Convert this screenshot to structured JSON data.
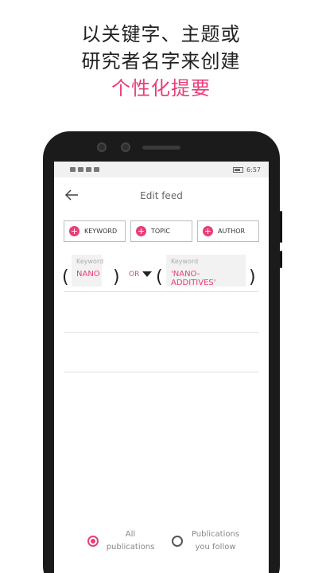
{
  "headline": {
    "line1": "以关键字、主题或",
    "line2": "研究者名字来创建",
    "line3": "个性化提要"
  },
  "statusbar": {
    "time": "6:57"
  },
  "appbar": {
    "title": "Edit feed"
  },
  "chips": [
    {
      "label": "KEYWORD"
    },
    {
      "label": "TOPIC"
    },
    {
      "label": "AUTHOR"
    }
  ],
  "query": {
    "open_paren": "(",
    "close_paren": ")",
    "left": {
      "label": "Keyword",
      "value": "NANO"
    },
    "operator": "OR",
    "right": {
      "label": "Keyword",
      "value": "'NANO-ADDITIVES'"
    }
  },
  "filters": {
    "all": {
      "label": "All publications",
      "selected": true
    },
    "following": {
      "label": "Publications you follow",
      "selected": false
    }
  },
  "colors": {
    "accent": "#e83e7a"
  }
}
